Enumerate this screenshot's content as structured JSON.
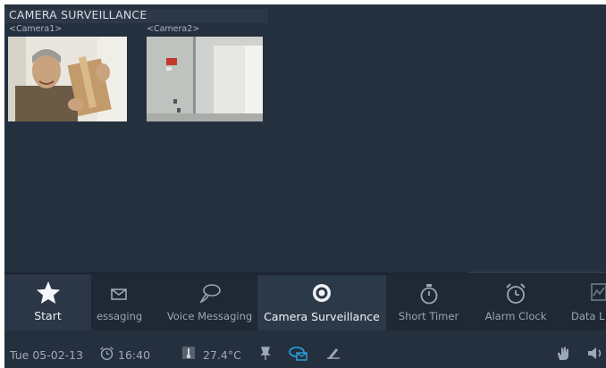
{
  "title": "CAMERA SURVEILLANCE",
  "cameras": [
    {
      "label": "<Camera1>"
    },
    {
      "label": "<Camera2>"
    }
  ],
  "dock": {
    "start": {
      "label": "Start",
      "icon": "star-icon"
    },
    "items": [
      {
        "label": "essaging",
        "icon": "envelope-icon"
      },
      {
        "label": "Voice Messaging",
        "icon": "speech-bubble-icon"
      },
      {
        "label": "Camera Surveillance",
        "icon": "camera-lens-icon",
        "active": true
      },
      {
        "label": "Short Timer",
        "icon": "stopwatch-icon"
      },
      {
        "label": "Alarm Clock",
        "icon": "alarm-clock-icon"
      },
      {
        "label": "Data L",
        "icon": "data-logger-icon"
      }
    ]
  },
  "status": {
    "date": "Tue 05-02-13",
    "alarm_time": "16:40",
    "temperature": "27.4°C"
  },
  "colors": {
    "background": "#25303f",
    "dock": "#1f2834",
    "accent": "#29a3e8"
  }
}
